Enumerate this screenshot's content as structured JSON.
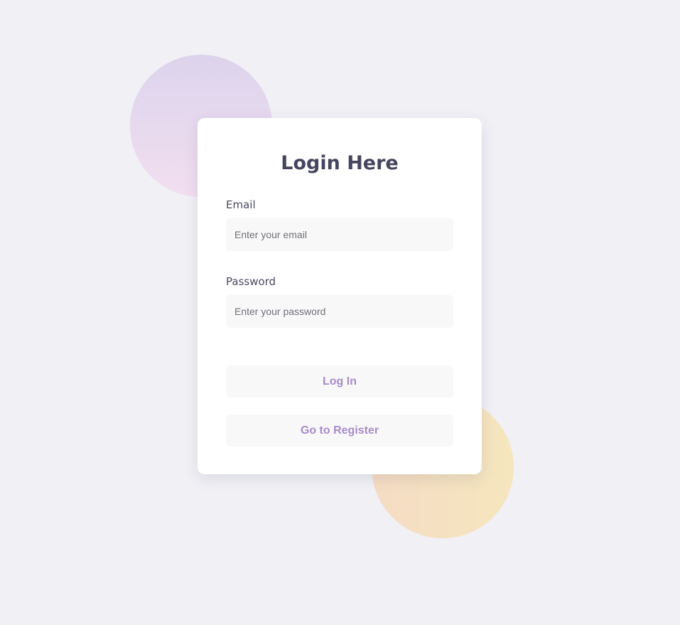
{
  "login": {
    "title": "Login Here",
    "email": {
      "label": "Email",
      "value": "",
      "placeholder": "Enter your email"
    },
    "password": {
      "label": "Password",
      "value": "",
      "placeholder": "Enter your password"
    },
    "login_button": "Log In",
    "register_button": "Go to Register"
  },
  "colors": {
    "background": "#f0f0f5",
    "card": "#ffffff",
    "title": "#45455f",
    "button_text": "#a88bcb",
    "field_background": "#f8f8f9",
    "blob_top": "#dcd4ec",
    "blob_bottom": "#f5e2c0"
  }
}
